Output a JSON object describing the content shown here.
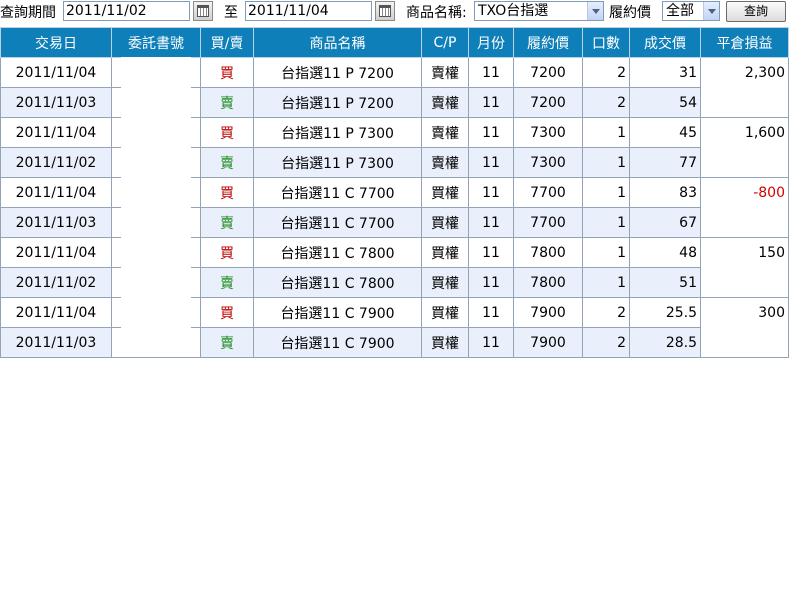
{
  "query": {
    "period_label": "查詢期間",
    "date_from": "2011/11/02",
    "to_label": "至",
    "date_to": "2011/11/04",
    "product_label": "商品名稱:",
    "product_value": "TXO台指選",
    "strike_label": "履約價",
    "strike_value": "全部",
    "query_button": "查詢"
  },
  "columns": [
    "交易日",
    "委託書號",
    "買/賣",
    "商品名稱",
    "C/P",
    "月份",
    "履約價",
    "口數",
    "成交價",
    "平倉損益"
  ],
  "rows": [
    {
      "date": "2011/11/04",
      "order_no": "",
      "side": "買",
      "product": "台指選11 P 7200",
      "cp": "賣權",
      "month": "11",
      "strike": "7200",
      "qty": "2",
      "price": "31"
    },
    {
      "date": "2011/11/03",
      "order_no": "",
      "side": "賣",
      "product": "台指選11 P 7200",
      "cp": "賣權",
      "month": "11",
      "strike": "7200",
      "qty": "2",
      "price": "54"
    },
    {
      "date": "2011/11/04",
      "order_no": "",
      "side": "買",
      "product": "台指選11 P 7300",
      "cp": "賣權",
      "month": "11",
      "strike": "7300",
      "qty": "1",
      "price": "45"
    },
    {
      "date": "2011/11/02",
      "order_no": "",
      "side": "賣",
      "product": "台指選11 P 7300",
      "cp": "賣權",
      "month": "11",
      "strike": "7300",
      "qty": "1",
      "price": "77"
    },
    {
      "date": "2011/11/04",
      "order_no": "",
      "side": "買",
      "product": "台指選11 C 7700",
      "cp": "買權",
      "month": "11",
      "strike": "7700",
      "qty": "1",
      "price": "83"
    },
    {
      "date": "2011/11/03",
      "order_no": "",
      "side": "賣",
      "product": "台指選11 C 7700",
      "cp": "買權",
      "month": "11",
      "strike": "7700",
      "qty": "1",
      "price": "67"
    },
    {
      "date": "2011/11/04",
      "order_no": "",
      "side": "買",
      "product": "台指選11 C 7800",
      "cp": "買權",
      "month": "11",
      "strike": "7800",
      "qty": "1",
      "price": "48"
    },
    {
      "date": "2011/11/02",
      "order_no": "",
      "side": "賣",
      "product": "台指選11 C 7800",
      "cp": "買權",
      "month": "11",
      "strike": "7800",
      "qty": "1",
      "price": "51"
    },
    {
      "date": "2011/11/04",
      "order_no": "",
      "side": "買",
      "product": "台指選11 C 7900",
      "cp": "買權",
      "month": "11",
      "strike": "7900",
      "qty": "2",
      "price": "25.5"
    },
    {
      "date": "2011/11/03",
      "order_no": "",
      "side": "賣",
      "product": "台指選11 C 7900",
      "cp": "買權",
      "month": "11",
      "strike": "7900",
      "qty": "2",
      "price": "28.5"
    }
  ],
  "pnl": [
    "2,300",
    "1,600",
    "-800",
    "150",
    "300"
  ],
  "colors": {
    "header_bg": "#0e7fb8",
    "buy": "#c00000",
    "sell": "#1a8a1a",
    "loss": "#d40000",
    "even_row": "#e9f0fb"
  },
  "icons": [
    "calendar-icon",
    "calendar-icon",
    "dropdown-arrow-icon",
    "dropdown-arrow-icon"
  ]
}
